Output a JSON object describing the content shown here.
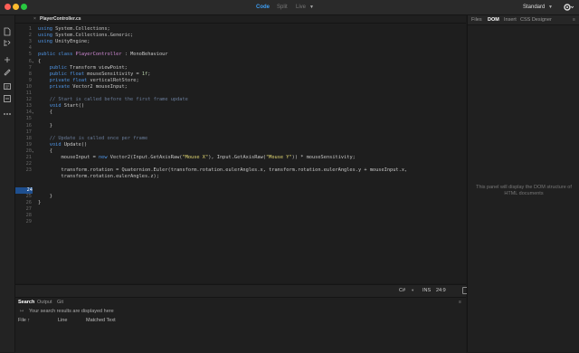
{
  "titlebar": {
    "view_modes": {
      "code": "Code",
      "split": "Split",
      "live": "Live"
    },
    "workspace": "Standard"
  },
  "file_tab": {
    "name": "PlayerController.cs"
  },
  "editor": {
    "lines": [
      {
        "n": "1",
        "fold": "",
        "html": "<span class=\"kw\">using</span> System.Collections;"
      },
      {
        "n": "2",
        "fold": "",
        "html": "<span class=\"kw\">using</span> System.Collections.Generic;"
      },
      {
        "n": "3",
        "fold": "",
        "html": "<span class=\"kw\">using</span> UnityEngine;"
      },
      {
        "n": "4",
        "fold": "",
        "html": ""
      },
      {
        "n": "5",
        "fold": "",
        "html": "<span class=\"kw\">public</span> <span class=\"kw\">class</span> <span class=\"cls\">PlayerController</span> : MonoBehaviour"
      },
      {
        "n": "6",
        "fold": "▾",
        "html": "{"
      },
      {
        "n": "7",
        "fold": "",
        "html": "    <span class=\"kw\">public</span> Transform viewPoint;"
      },
      {
        "n": "8",
        "fold": "",
        "html": "    <span class=\"kw\">public</span> <span class=\"ty\">float</span> mouseSensitivity = <span class=\"num\">1f</span>;"
      },
      {
        "n": "9",
        "fold": "",
        "html": "    <span class=\"kw\">private</span> <span class=\"ty\">float</span> verticalRotStore;"
      },
      {
        "n": "10",
        "fold": "",
        "html": "    <span class=\"kw\">private</span> Vector2 mouseInput;"
      },
      {
        "n": "11",
        "fold": "",
        "html": ""
      },
      {
        "n": "12",
        "fold": "",
        "html": "    <span class=\"cm\">// Start is called before the first frame update</span>"
      },
      {
        "n": "13",
        "fold": "",
        "html": "    <span class=\"ty\">void</span> Start()"
      },
      {
        "n": "14",
        "fold": "▾",
        "html": "    {"
      },
      {
        "n": "15",
        "fold": "",
        "html": ""
      },
      {
        "n": "16",
        "fold": "",
        "html": "    }"
      },
      {
        "n": "17",
        "fold": "",
        "html": ""
      },
      {
        "n": "18",
        "fold": "",
        "html": "    <span class=\"cm\">// Update is called once per frame</span>"
      },
      {
        "n": "19",
        "fold": "",
        "html": "    <span class=\"ty\">void</span> Update()"
      },
      {
        "n": "20",
        "fold": "▾",
        "html": "    {"
      },
      {
        "n": "21",
        "fold": "",
        "html": "        mouseInput = <span class=\"kw\">new</span> Vector2(Input.GetAxisRaw(<span class=\"str\">\"Mouse X\"</span>), Input.GetAxisRaw(<span class=\"str\">\"Mouse Y\"</span>)) * mouseSensitivity;"
      },
      {
        "n": "22",
        "fold": "",
        "html": ""
      },
      {
        "n": "23",
        "fold": "",
        "html": "        transform.rotation = Quaternion.Euler(transform.rotation.eulerAngles.x, transform.rotation.eulerAngles.y + mouseInput.x,"
      },
      {
        "n": "",
        "fold": "",
        "html": "        transform.rotation.eulerAngles.z);"
      },
      {
        "n": "",
        "fold": "",
        "html": ""
      },
      {
        "n": "24",
        "fold": "",
        "html": "",
        "current": true
      },
      {
        "n": "25",
        "fold": "",
        "html": "    }"
      },
      {
        "n": "26",
        "fold": "",
        "html": "}"
      },
      {
        "n": "27",
        "fold": "",
        "html": ""
      },
      {
        "n": "28",
        "fold": "",
        "html": ""
      },
      {
        "n": "29",
        "fold": "",
        "html": ""
      }
    ]
  },
  "status": {
    "language": "C#",
    "mode": "INS",
    "cursor": "24:9"
  },
  "bottom_panel": {
    "tabs": {
      "search": "Search",
      "output": "Output",
      "git": "Git"
    },
    "info": "Your search results are displayed here",
    "columns": {
      "file": "File ↑",
      "line": "Line",
      "matched": "Matched Text"
    }
  },
  "right_panel": {
    "tabs": {
      "files": "Files",
      "dom": "DOM",
      "insert": "Insert",
      "css": "CSS Designer"
    },
    "empty_message_1": "This panel will display the DOM structure of",
    "empty_message_2": "HTML documents"
  },
  "colors": {
    "accent": "#3d9df2",
    "current_line": "#1e4f8f"
  },
  "icons": [
    "file-icon",
    "file-tree-icon",
    "branch-icon",
    "pen-icon",
    "code-hint-icon",
    "dom-icon",
    "more-icon",
    "gear-icon",
    "preview-icon"
  ]
}
